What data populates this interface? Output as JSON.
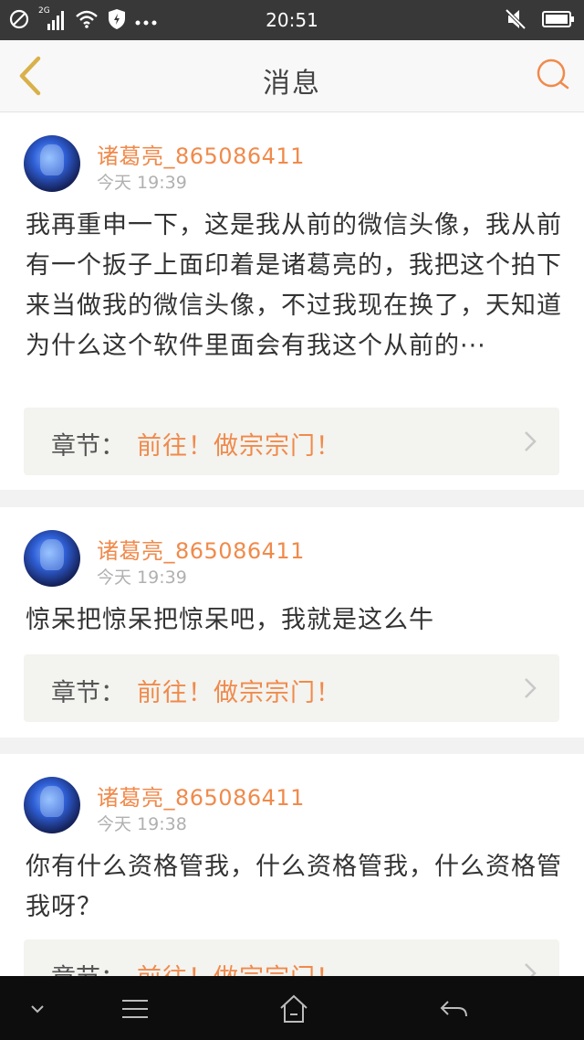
{
  "status_bar": {
    "time": "20:51",
    "left_icons": [
      "blocked-circle-icon",
      "signal-2g-icon",
      "wifi-icon",
      "shield-icon",
      "more-dots-icon"
    ],
    "signal_label": "2G",
    "right_icons": [
      "mute-icon",
      "battery-icon"
    ]
  },
  "nav": {
    "title": "消息",
    "back_icon": "chevron-left-icon",
    "search_icon": "search-icon",
    "accent": "#f08a4b"
  },
  "messages": [
    {
      "username": "诸葛亮_865086411",
      "time": "今天 19:39",
      "content": "我再重申一下，这是我从前的微信头像，我从前有一个扳子上面印着是诸葛亮的，我把这个拍下来当做我的微信头像，不过我现在换了，天知道为什么这个软件里面会有我这个从前的···",
      "chapter_label": "章节：",
      "chapter_link": "前往！做宗宗门！"
    },
    {
      "username": "诸葛亮_865086411",
      "time": "今天 19:39",
      "content": "惊呆把惊呆把惊呆吧，我就是这么牛",
      "chapter_label": "章节：",
      "chapter_link": "前往！做宗宗门！"
    },
    {
      "username": "诸葛亮_865086411",
      "time": "今天 19:38",
      "content": "你有什么资格管我，什么资格管我，什么资格管我呀？",
      "chapter_label": "章节：",
      "chapter_link": "前往！做宗宗门！"
    }
  ],
  "bottom_nav": {
    "icons": [
      "chevron-down-icon",
      "menu-icon",
      "home-icon",
      "back-arrow-icon"
    ]
  }
}
